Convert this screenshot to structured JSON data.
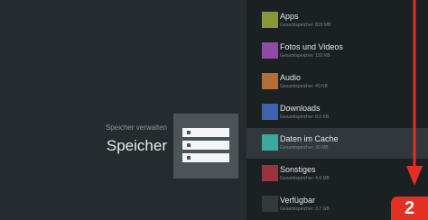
{
  "header": {
    "subtitle": "Speicher verwalten",
    "title": "Speicher"
  },
  "storage_icon": {
    "name": "storage-icon",
    "color": "#4b5458"
  },
  "list": {
    "items": [
      {
        "label": "Apps",
        "detail": "Gesamtspeicher: 829 MB",
        "color": "#8a963a",
        "selected": false
      },
      {
        "label": "Fotos und Videos",
        "detail": "Gesamtspeicher: 192 KB",
        "color": "#8f4ba8",
        "selected": false
      },
      {
        "label": "Audio",
        "detail": "Gesamtspeicher: 40 KB",
        "color": "#b26e38",
        "selected": false
      },
      {
        "label": "Downloads",
        "detail": "Gesamtspeicher: 8,0 KB",
        "color": "#3f64ac",
        "selected": false
      },
      {
        "label": "Daten im Cache",
        "detail": "Gesamtspeicher: 30 MB",
        "color": "#3ea89c",
        "selected": true
      },
      {
        "label": "Sonstiges",
        "detail": "Gesamtspeicher: 4,6 MB",
        "color": "#9d323f",
        "selected": false
      },
      {
        "label": "Verfügbar",
        "detail": "Gesamtspeicher: 3,7 GB",
        "color": "#33393d",
        "selected": false
      }
    ]
  },
  "annotation": {
    "step": "2",
    "color": "#e52f23"
  }
}
